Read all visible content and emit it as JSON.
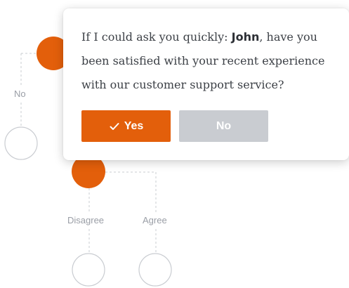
{
  "survey": {
    "question_prefix": "If I could ask you quickly: ",
    "customer_name": "John",
    "question_suffix": ", have you been satisfied with your recent experience with our customer support service?",
    "yes_label": "Yes",
    "no_label": "No"
  },
  "flow": {
    "branch_no_label": "No",
    "branch_disagree_label": "Disagree",
    "branch_agree_label": "Agree"
  },
  "colors": {
    "accent": "#e35f0b",
    "muted_button": "#c9ccd1",
    "connector": "#c9ccd1"
  },
  "icons": {
    "yes_button": "check-icon"
  }
}
